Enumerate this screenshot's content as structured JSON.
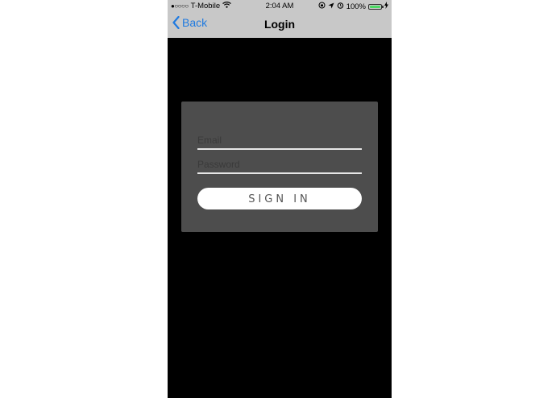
{
  "status_bar": {
    "signal": "●○○○○",
    "carrier": "T-Mobile",
    "time": "2:04 AM",
    "battery_percent": "100%",
    "battery_level": 1.0
  },
  "nav": {
    "back_label": "Back",
    "title": "Login"
  },
  "form": {
    "email_placeholder": "Email",
    "email_value": "",
    "password_placeholder": "Password",
    "password_value": "",
    "signin_label": "SIGN IN"
  },
  "colors": {
    "nav_background": "#c8c8c8",
    "accent": "#1f7ae0",
    "screen_background": "#000000",
    "card_background": "#4d4d4d",
    "battery": "#4cd964"
  }
}
